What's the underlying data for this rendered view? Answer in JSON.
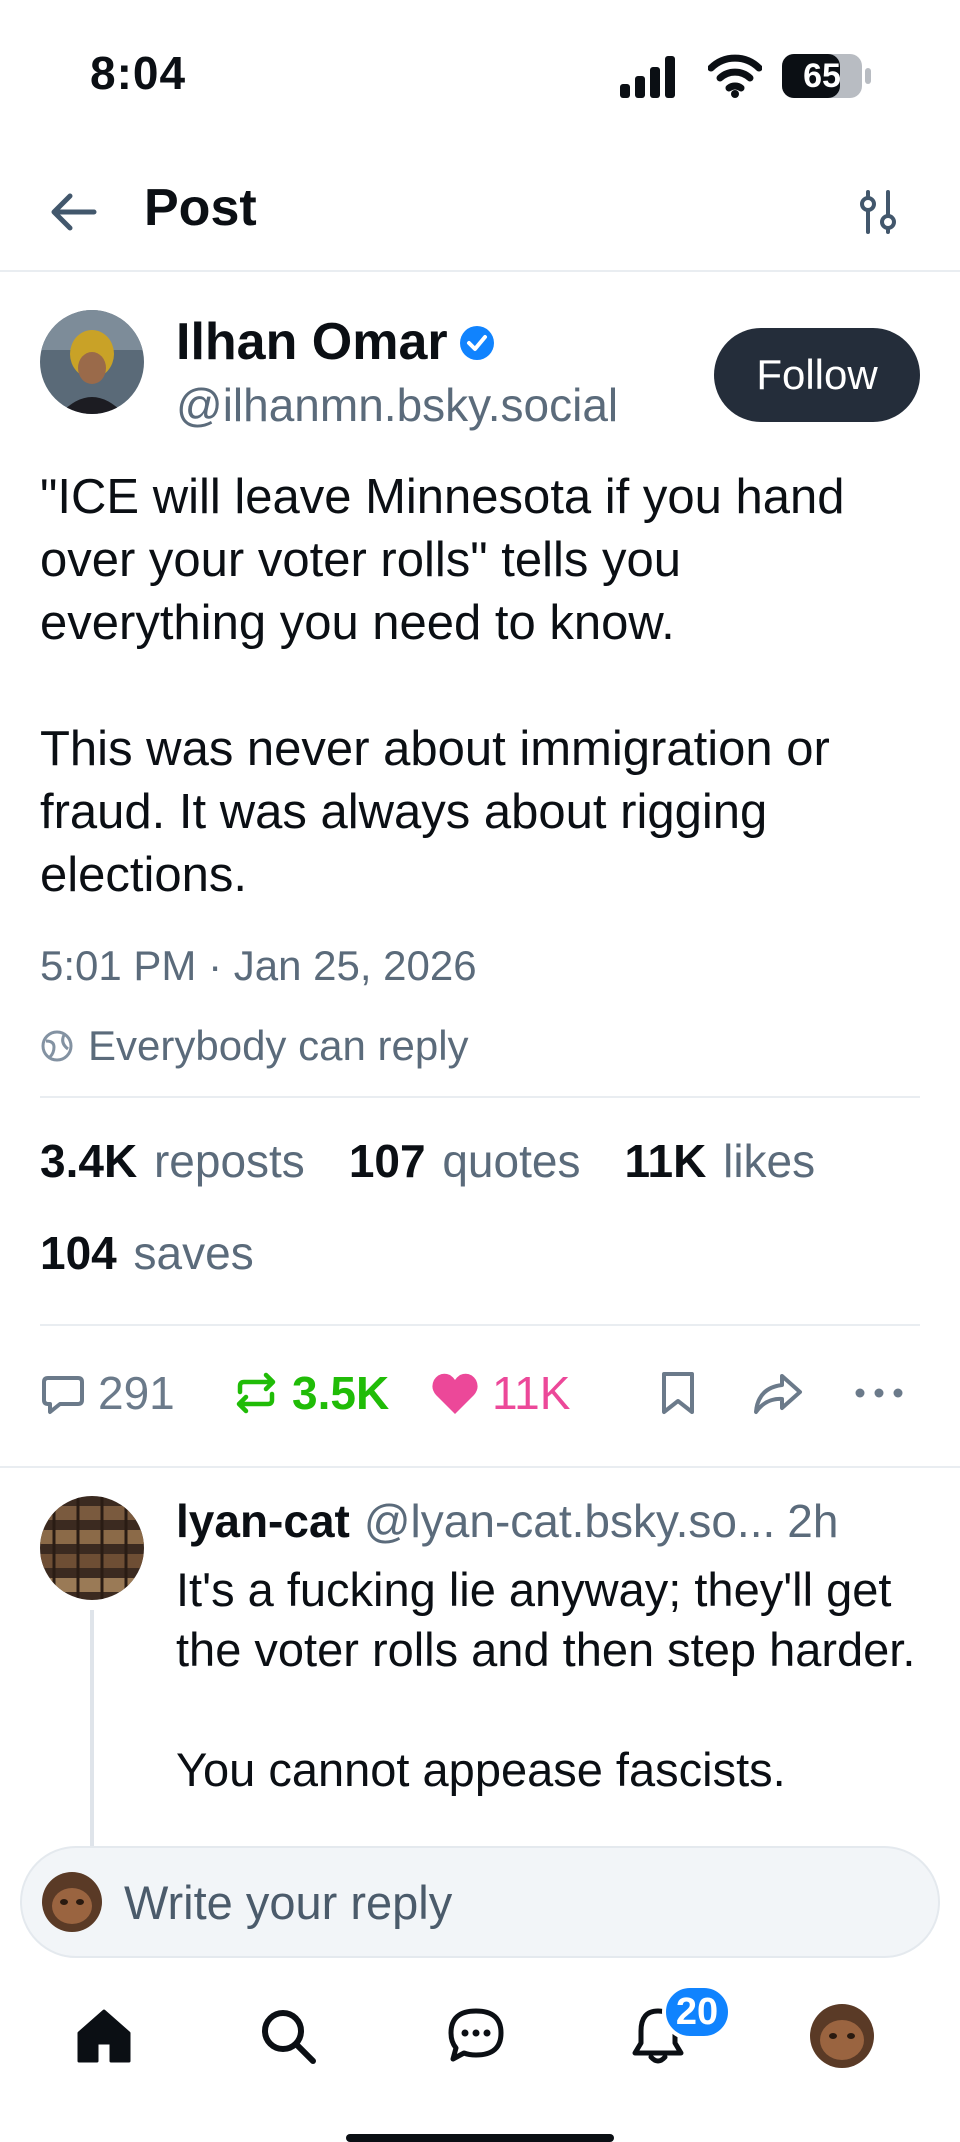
{
  "status_bar": {
    "time": "8:04",
    "battery": "65"
  },
  "header": {
    "title": "Post"
  },
  "post": {
    "author_name": "Ilhan Omar",
    "author_handle": "@ilhanmn.bsky.social",
    "follow_label": "Follow",
    "text_paragraphs": [
      "\"ICE will leave Minnesota if you hand over your voter rolls\" tells you everything you need to know.",
      "This was never about immigration or fraud. It was always about rigging elections."
    ],
    "timestamp": "5:01 PM · Jan 25, 2026",
    "reply_setting": "Everybody can reply"
  },
  "stats": {
    "reposts": {
      "count": "3.4K",
      "label": "reposts"
    },
    "quotes": {
      "count": "107",
      "label": "quotes"
    },
    "likes": {
      "count": "11K",
      "label": "likes"
    },
    "saves": {
      "count": "104",
      "label": "saves"
    }
  },
  "actions": {
    "reply_count": "291",
    "repost_count": "3.5K",
    "like_count": "11K",
    "repost_color": "#20bc07",
    "like_color": "#ec4899"
  },
  "reply": {
    "author_name": "lyan-cat",
    "author_handle": "@lyan-cat.bsky.so...",
    "age": "2h",
    "text_paragraphs": [
      "It's a fucking lie anyway; they'll get the voter rolls and then step harder.",
      "You cannot appease fascists."
    ]
  },
  "composer": {
    "placeholder": "Write your reply"
  },
  "bottom_nav": {
    "notification_badge": "20"
  },
  "icons": [
    "back-arrow-icon",
    "filter-sliders-icon",
    "verified-icon",
    "globe-icon",
    "reply-icon",
    "repost-icon",
    "heart-icon",
    "bookmark-icon",
    "share-icon",
    "more-icon",
    "home-icon",
    "search-icon",
    "chat-icon",
    "bell-icon"
  ],
  "colors": {
    "accent": "#1083fe",
    "follow_button": "#242d3a",
    "muted_text": "#5b6b7b"
  }
}
